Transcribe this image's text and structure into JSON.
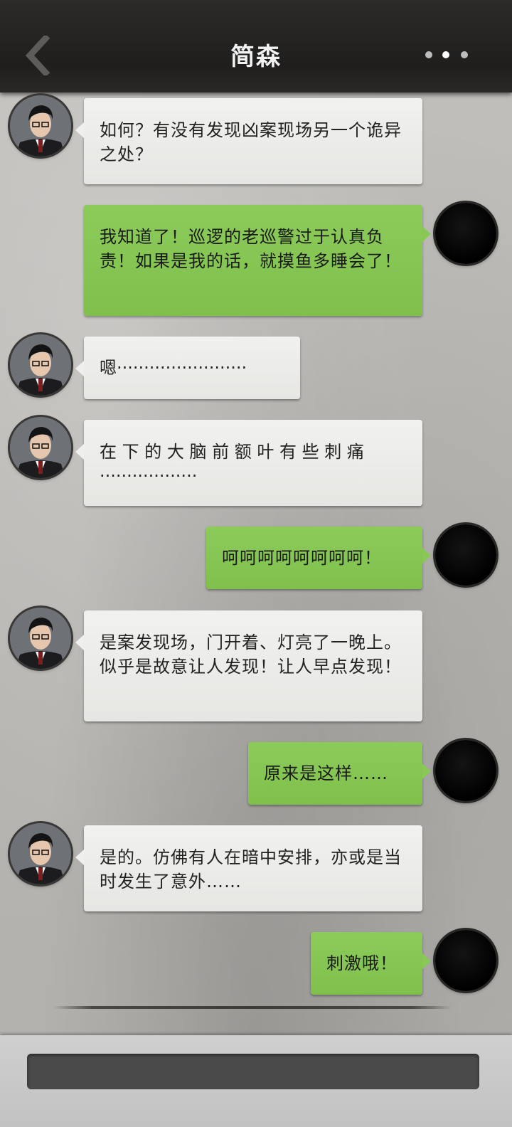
{
  "header": {
    "title": "简森",
    "back_icon": "chevron-left-icon",
    "more_icon": "more-dots-icon"
  },
  "messages": [
    {
      "sender": "npc",
      "text": "如何？有没有发现凶案现场另一个诡异之处？"
    },
    {
      "sender": "me",
      "text": "我知道了！巡逻的老巡警过于认真负责！如果是我的话，就摸鱼多睡会了！"
    },
    {
      "sender": "npc",
      "text": "嗯························"
    },
    {
      "sender": "npc",
      "text": "在 下 的 大 脑 前 额 叶 有 些 刺 痛··················"
    },
    {
      "sender": "me",
      "text": "呵呵呵呵呵呵呵呵！"
    },
    {
      "sender": "npc",
      "text": "是案发现场，门开着、灯亮了一晚上。似乎是故意让人发现！让人早点发现！"
    },
    {
      "sender": "me",
      "text": "原来是这样……"
    },
    {
      "sender": "npc",
      "text": "是的。仿佛有人在暗中安排，亦或是当时发生了意外……"
    },
    {
      "sender": "me",
      "text": "刺激哦！"
    }
  ],
  "input": {
    "placeholder": ""
  },
  "colors": {
    "header_bg": "#222120",
    "npc_bubble": "#ececea",
    "me_bubble": "#86c652",
    "input_bg": "#4a4a4a"
  }
}
